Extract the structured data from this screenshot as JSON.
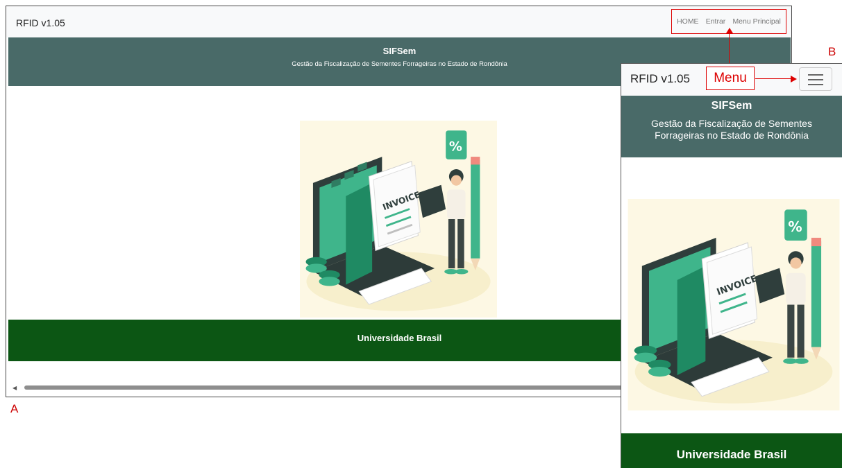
{
  "desktop": {
    "brand": "RFID v1.05",
    "nav": [
      "HOME",
      "Entrar",
      "Menu Principal"
    ],
    "header": {
      "title": "SIFSem",
      "subtitle": "Gestão da Fiscalização de Sementes Forrageiras no Estado de Rondônia"
    },
    "illustration": {
      "label": "INVOICE",
      "percent": "%"
    },
    "footer": "Universidade Brasil",
    "panel_label": "A"
  },
  "mobile": {
    "brand": "RFID v1.05",
    "menu_annotation": "Menu",
    "header": {
      "title": "SIFSem",
      "subtitle": "Gestão da Fiscalização de Sementes Forrageiras no Estado de Rondônia"
    },
    "illustration": {
      "label": "INVOICE",
      "percent": "%"
    },
    "footer": "Universidade Brasil",
    "panel_label": "B"
  },
  "colors": {
    "header": "#496a68",
    "footer": "#0c5614",
    "annotation": "#dd0000",
    "accent": "#3bb38a"
  }
}
